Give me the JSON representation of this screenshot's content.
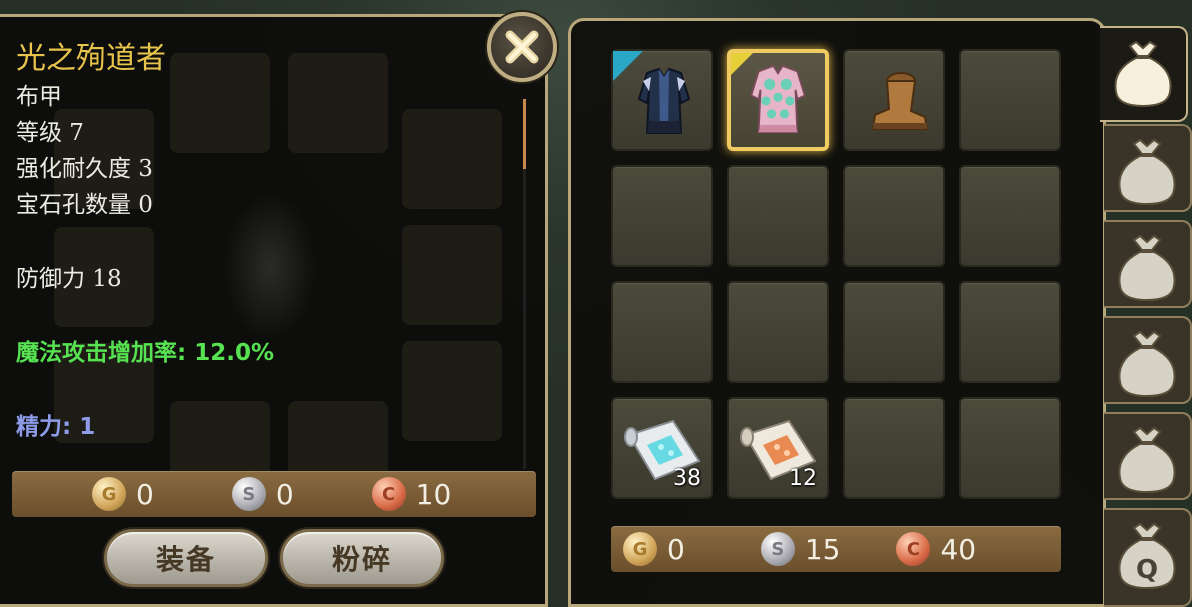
{
  "item": {
    "name": "光之殉道者",
    "type": "布甲",
    "level": "等级 7",
    "durability": "强化耐久度 3",
    "gem_slots": "宝石孔数量 0",
    "defense": "防御力 18",
    "bonus": "魔法攻击增加率: 12.0%",
    "energy": "精力: 1"
  },
  "item_price": {
    "gold": "0",
    "silver": "0",
    "copper": "10"
  },
  "buttons": {
    "equip": "装备",
    "smash": "粉碎"
  },
  "inventory": {
    "slots": [
      {
        "item": "dark-robe",
        "rarity_color": "#2aa7c4",
        "count": ""
      },
      {
        "item": "pink-robe",
        "rarity_color": "#e5d03a",
        "count": "",
        "selected": true
      },
      {
        "item": "leather-boots",
        "count": ""
      },
      {
        "item": "",
        "count": ""
      },
      {
        "item": "",
        "count": ""
      },
      {
        "item": "",
        "count": ""
      },
      {
        "item": "",
        "count": ""
      },
      {
        "item": "",
        "count": ""
      },
      {
        "item": "",
        "count": ""
      },
      {
        "item": "",
        "count": ""
      },
      {
        "item": "",
        "count": ""
      },
      {
        "item": "",
        "count": ""
      },
      {
        "item": "blue-scroll",
        "count": "38"
      },
      {
        "item": "orange-scroll",
        "count": "12"
      },
      {
        "item": "",
        "count": ""
      },
      {
        "item": "",
        "count": ""
      }
    ]
  },
  "wallet": {
    "gold": "0",
    "silver": "15",
    "copper": "40"
  },
  "coin_letters": {
    "gold": "G",
    "silver": "S",
    "copper": "C"
  },
  "tabs": [
    {
      "icon": "bag-icon",
      "active": true
    },
    {
      "icon": "bag-icon"
    },
    {
      "icon": "bag-icon"
    },
    {
      "icon": "bag-icon"
    },
    {
      "icon": "bag-icon"
    },
    {
      "icon": "quest-bag-icon",
      "letter": "Q"
    }
  ],
  "colors": {
    "frame": "#b9a77c",
    "name": "#e8c44c",
    "bonus": "#57e251",
    "energy": "#8e9be8",
    "selected": "#f0cb61"
  }
}
